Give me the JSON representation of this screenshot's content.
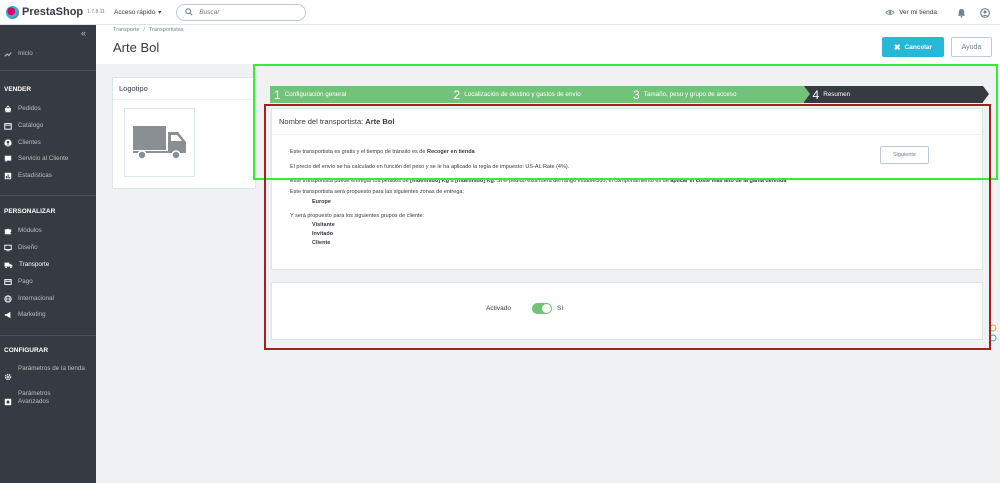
{
  "topbar": {
    "brand": "PrestaShop",
    "version": "1.7.8.11",
    "quick_access": "Acceso rápido",
    "search_placeholder": "Buscar",
    "view_store": "Ver mi tienda"
  },
  "sidebar": {
    "home": "Inicio",
    "sections": [
      {
        "title": "VENDER",
        "items": [
          "Pedidos",
          "Catálogo",
          "Clientes",
          "Servicio al Cliente",
          "Estadísticas"
        ]
      },
      {
        "title": "PERSONALIZAR",
        "items": [
          "Módulos",
          "Diseño",
          "Transporte",
          "Pago",
          "Internacional",
          "Marketing"
        ]
      },
      {
        "title": "CONFIGURAR",
        "items": [
          "Parámetros de la tienda",
          "Parámetros Avanzados"
        ]
      }
    ]
  },
  "header": {
    "breadcrumb": [
      "Transporte",
      "Transportistas"
    ],
    "title": "Arte Bol",
    "cancel_label": "Cancelar",
    "help_label": "Ayuda"
  },
  "logo_panel": {
    "title": "Logotipo",
    "icon": "truck-icon"
  },
  "wizard": {
    "steps": [
      {
        "num": "1",
        "label": "Configuración general",
        "state": "done"
      },
      {
        "num": "2",
        "label": "Localización de destino y gastos de envío",
        "state": "done"
      },
      {
        "num": "3",
        "label": "Tamaño, peso y grupo de acceso",
        "state": "done"
      },
      {
        "num": "4",
        "label": "Resumen",
        "state": "active"
      }
    ]
  },
  "summary": {
    "title_prefix": "Nombre del transportista:",
    "carrier_name": "Arte Bol",
    "line1_prefix": "Este transportista es gratis y el tiempo de tránsito es de",
    "line1_bold": "Recoger en tienda",
    "line2": "El precio del envío se ha calculado en función del peso y se le ha aplicado la regla de impuesto: US-AL Rate (4%).",
    "line3_prefix": "Este transportista puede entregar los pedidos de",
    "line3_bold1": "[indefinido] Kg",
    "line3_mid": "a",
    "line3_bold2": "[indefinido] Kg",
    "line3_rest": ". Si el pedido está fuera del rango establecido, el comportamiento es de",
    "line3_bold3": "aplicar el coste más alto de la gama definida",
    "line4": "Este transportista será propuesto para las siguientes zonas de entrega:",
    "zones": [
      "Europe"
    ],
    "line5": "Y será propuesto para los siguientes grupos de cliente:",
    "groups": [
      "Visitante",
      "Invitado",
      "Cliente"
    ],
    "next_label": "Siguiente"
  },
  "status": {
    "label": "Activado",
    "value": "Sí",
    "enabled": true
  },
  "colors": {
    "sidebar": "#363a41",
    "accent": "#25b9d7",
    "step_done": "#72c279",
    "step_active": "#363a41",
    "frame_green": "#33ee33",
    "frame_red": "#a51f1f"
  }
}
